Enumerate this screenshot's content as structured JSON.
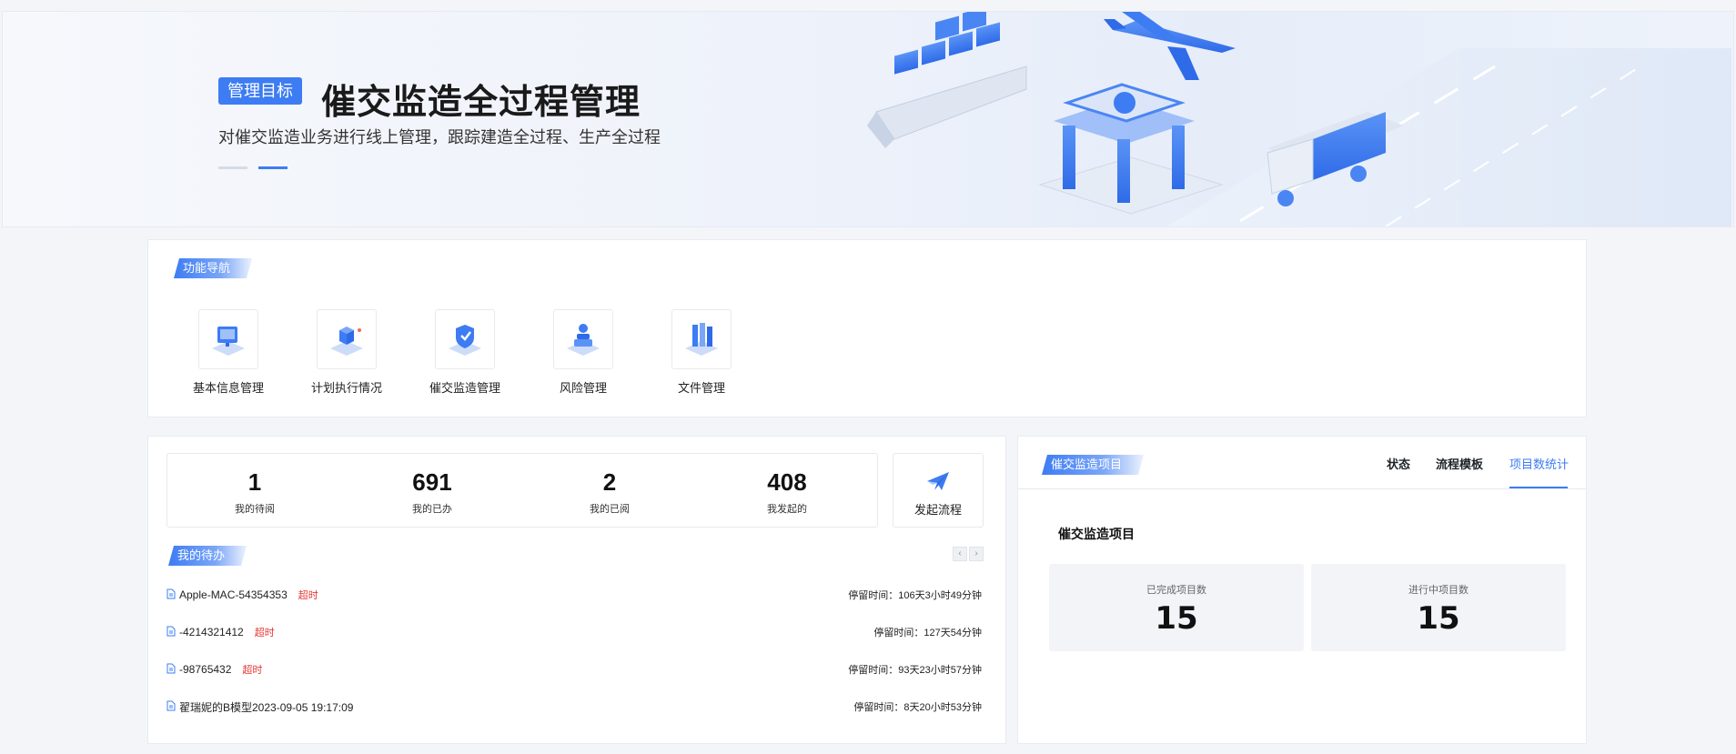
{
  "banner": {
    "tag": "管理目标",
    "title": "催交监造全过程管理",
    "subtitle": "对催交监造业务进行线上管理，跟踪建造全过程、生产全过程"
  },
  "nav": {
    "section_title": "功能导航",
    "items": [
      {
        "label": "基本信息管理",
        "icon": "monitor-icon"
      },
      {
        "label": "计划执行情况",
        "icon": "cube-icon"
      },
      {
        "label": "催交监造管理",
        "icon": "shield-icon"
      },
      {
        "label": "风险管理",
        "icon": "risk-icon"
      },
      {
        "label": "文件管理",
        "icon": "files-icon"
      }
    ]
  },
  "stats": [
    {
      "value": "1",
      "label": "我的待阅"
    },
    {
      "value": "691",
      "label": "我的已办"
    },
    {
      "value": "2",
      "label": "我的已阅"
    },
    {
      "value": "408",
      "label": "我发起的"
    }
  ],
  "launch": {
    "label": "发起流程",
    "icon": "paper-plane-icon"
  },
  "todo": {
    "section_title": "我的待办",
    "prev": "‹",
    "next": "›",
    "items": [
      {
        "name": "Apple-MAC-54354353",
        "tag": "超时",
        "time": "停留时间：106天3小时49分钟"
      },
      {
        "name": "-4214321412",
        "tag": "超时",
        "time": "停留时间：127天54分钟"
      },
      {
        "name": "-98765432",
        "tag": "超时",
        "time": "停留时间：93天23小时57分钟"
      },
      {
        "name": "翟瑞妮的B模型2023-09-05 19:17:09",
        "tag": "",
        "time": "停留时间：8天20小时53分钟"
      }
    ]
  },
  "project": {
    "section_title": "催交监造项目",
    "tabs": [
      "状态",
      "流程模板",
      "项目数统计"
    ],
    "active_tab": "项目数统计",
    "title": "催交监造项目",
    "completed_label": "已完成项目数",
    "completed_value": "15",
    "inprogress_label": "进行中项目数",
    "inprogress_value": "15"
  },
  "colors": {
    "accent": "#3d7cf3",
    "overdue": "#e53935"
  }
}
